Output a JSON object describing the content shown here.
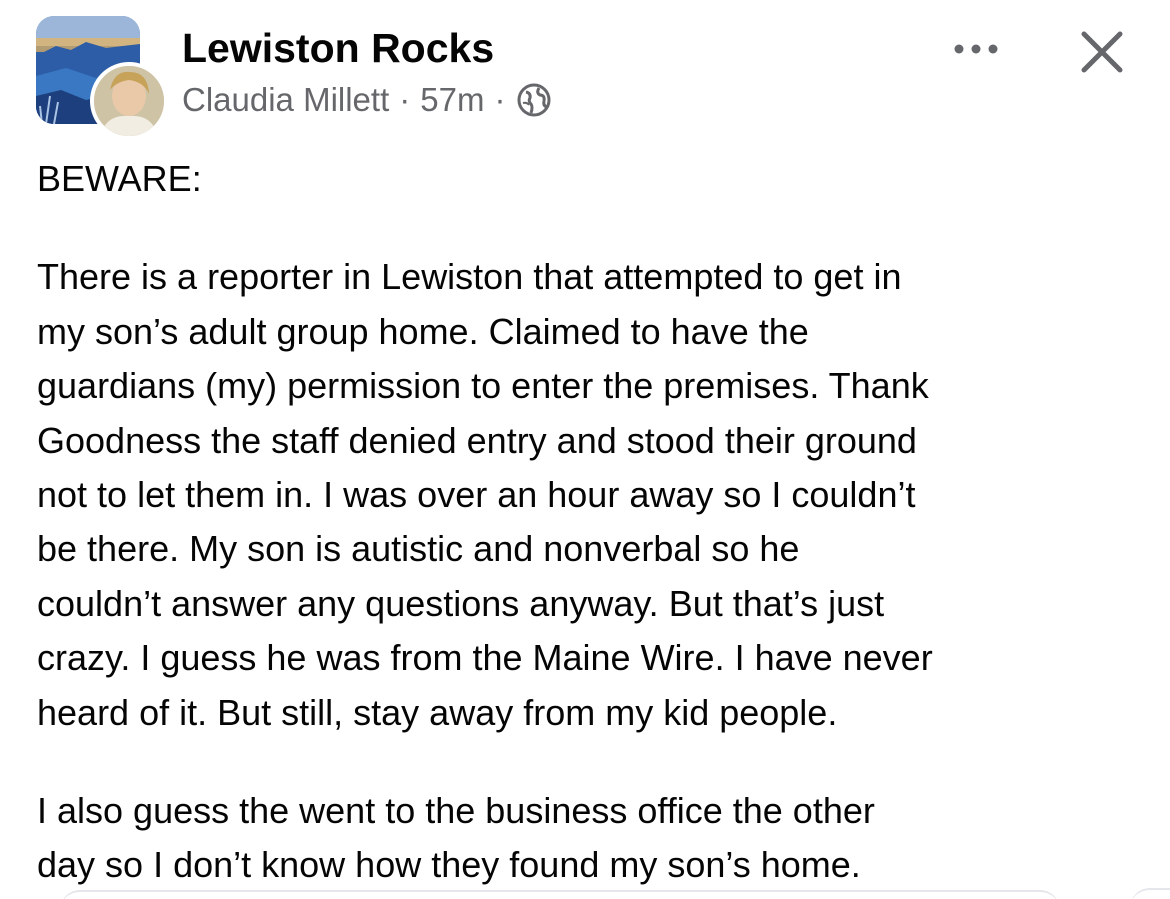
{
  "post": {
    "group_name": "Lewiston Rocks",
    "author": "Claudia Millett",
    "separator": "·",
    "time": "57m",
    "audience_icon": "globe-icon",
    "paragraphs": [
      "BEWARE:",
      "There is a reporter in Lewiston that attempted to get in\nmy son’s adult group home. Claimed to have the\nguardians (my) permission to enter the premises. Thank\nGoodness the staff denied entry and stood their ground\nnot to let them in.  I was over an hour away so I couldn’t\nbe there.  My son is autistic and nonverbal so he\ncouldn’t answer any questions anyway.  But that’s just\ncrazy.  I guess he was from the Maine Wire.  I have never\nheard of it. But still, stay away from my kid people.",
      "I also guess the went to the business office the other\nday so I don’t know how they found my son’s home."
    ]
  },
  "header": {
    "more_icon": "more-options-icon",
    "close_icon": "close-icon"
  },
  "colors": {
    "text_primary": "#050505",
    "text_secondary": "#65676b",
    "background": "#ffffff"
  }
}
